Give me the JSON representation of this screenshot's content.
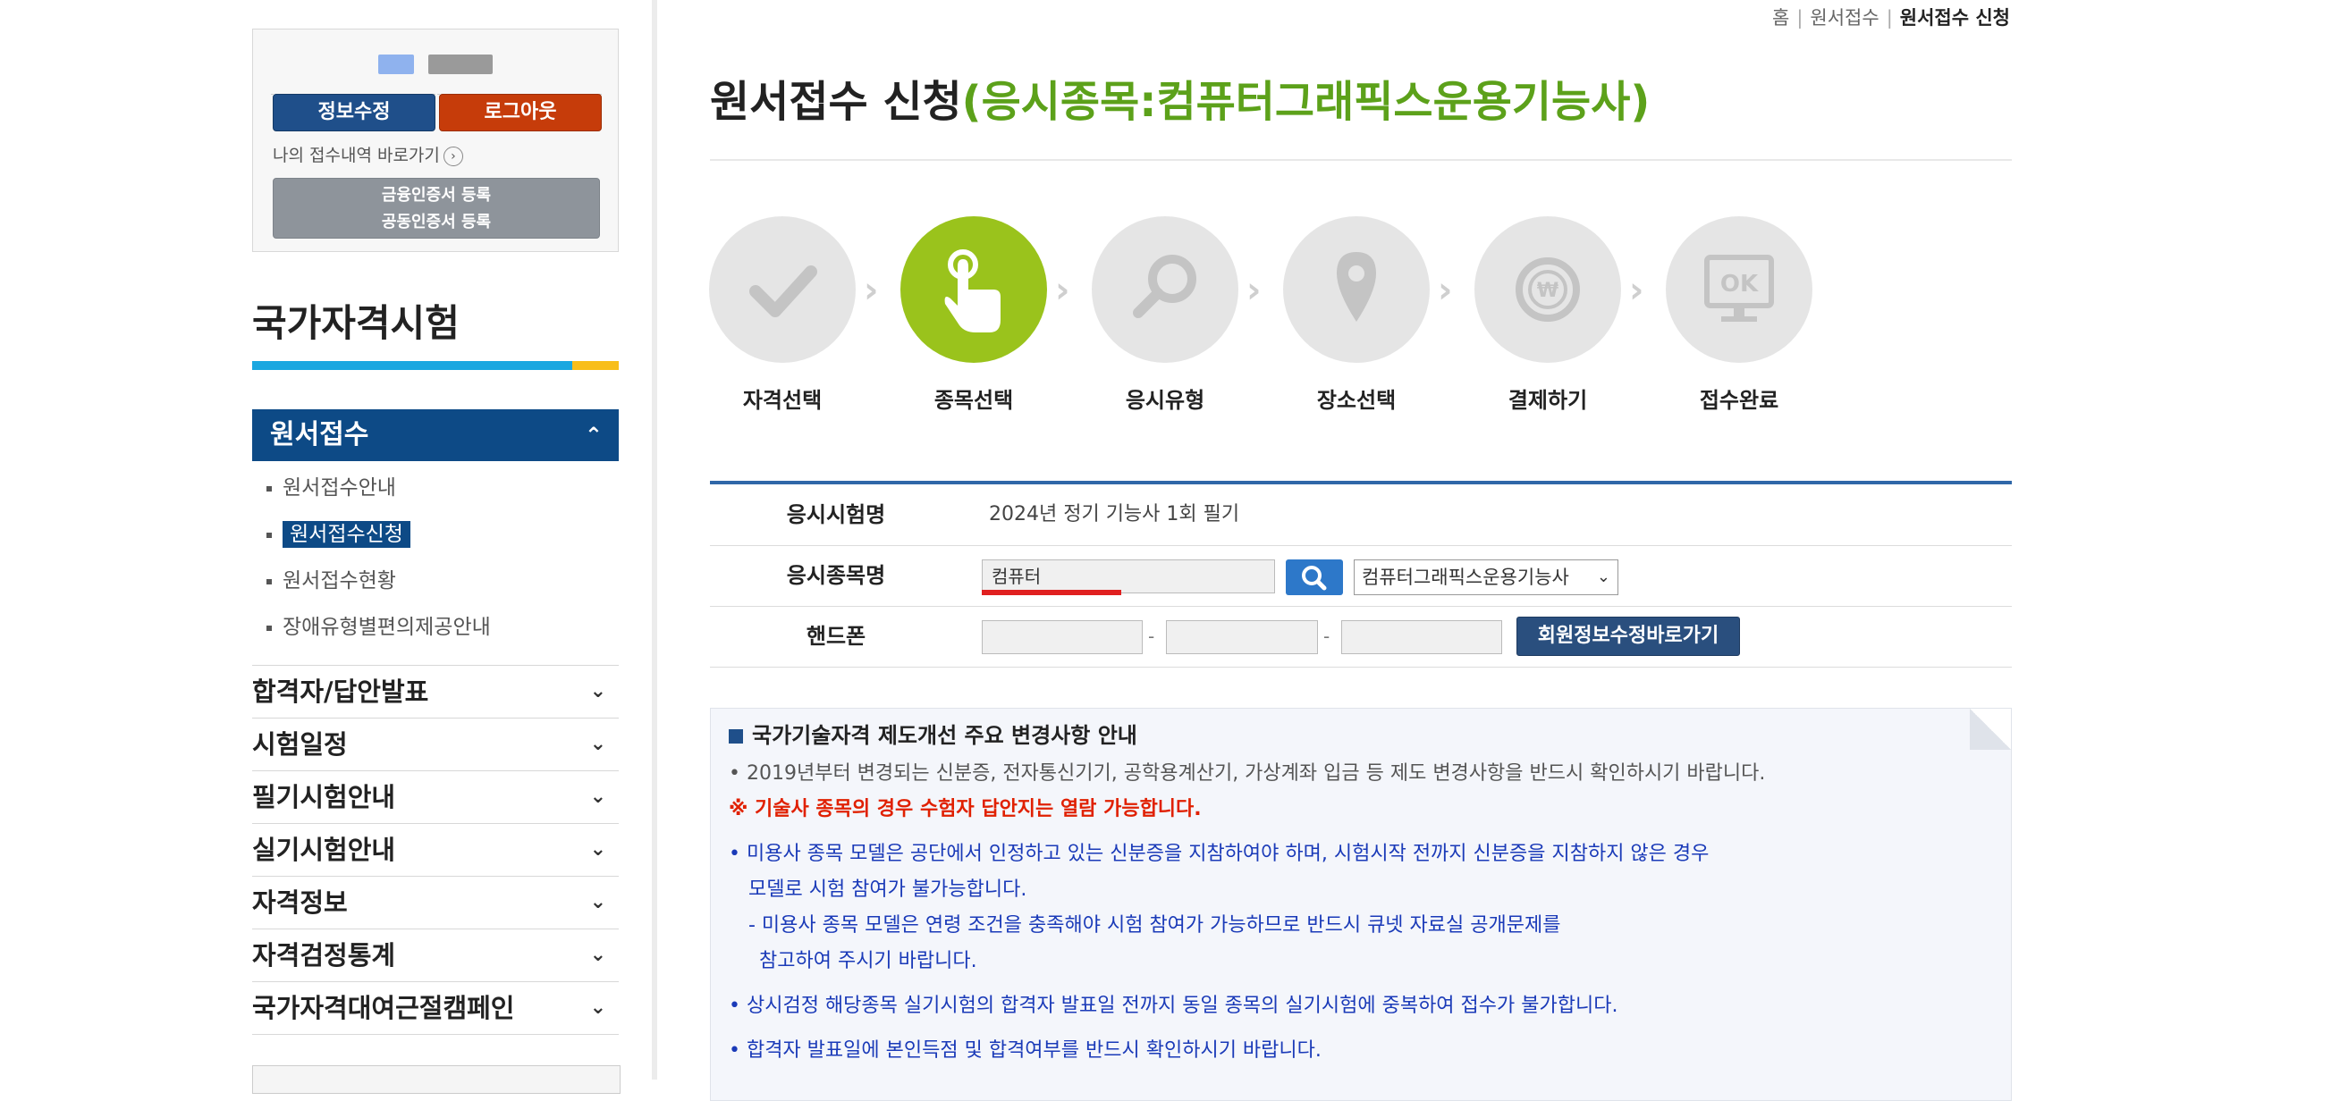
{
  "sidebar": {
    "login": {
      "edit_button": "정보수정",
      "logout_button": "로그아웃",
      "my_receipt_link": "나의 접수내역 바로가기",
      "cert_register": [
        "금융인증서 등록",
        "공동인증서 등록"
      ]
    },
    "section_title": "국가자격시험",
    "active_menu": "원서접수",
    "sub_items": [
      "원서접수안내",
      "원서접수신청",
      "원서접수현황",
      "장애유형별편의제공안내"
    ],
    "selected_sub_index": 1,
    "menu_items": [
      "합격자/답안발표",
      "시험일정",
      "필기시험안내",
      "실기시험안내",
      "자격정보",
      "자격검정통계",
      "국가자격대여근절캠페인"
    ]
  },
  "breadcrumb": [
    "홈",
    "원서접수",
    "원서접수 신청"
  ],
  "page_title": {
    "main": "원서접수 신청",
    "sub": "(응시종목:컴퓨터그래픽스운용기능사)"
  },
  "steps": [
    {
      "label": "자격선택",
      "icon": "check-icon",
      "active": false
    },
    {
      "label": "종목선택",
      "icon": "pointer-hand-icon",
      "active": true
    },
    {
      "label": "응시유형",
      "icon": "magnifier-icon",
      "active": false
    },
    {
      "label": "장소선택",
      "icon": "location-pin-icon",
      "active": false
    },
    {
      "label": "결제하기",
      "icon": "won-coin-icon",
      "active": false
    },
    {
      "label": "접수완료",
      "icon": "ok-monitor-icon",
      "active": false
    }
  ],
  "form": {
    "exam_name_label": "응시시험명",
    "exam_name_value": "2024년 정기 기능사 1회 필기",
    "subject_label": "응시종목명",
    "subject_input": "컴퓨터",
    "subject_select": "컴퓨터그래픽스운용기능사",
    "phone_label": "핸드폰",
    "phone_separator": "-",
    "member_edit_button": "회원정보수정바로가기"
  },
  "notice": {
    "title": "국가기술자격 제도개선 주요 변경사항 안내",
    "lines": [
      "• 2019년부터 변경되는 신분증, 전자통신기기, 공학용계산기, 가상계좌 입금 등 제도 변경사항을 반드시 확인하시기 바랍니다.",
      "※ 기술사 종목의 경우 수험자 답안지는 열람 가능합니다.",
      "• 미용사 종목 모델은 공단에서 인정하고 있는 신분증을 지참하여야 하며, 시험시작 전까지 신분증을 지참하지 않은 경우",
      "모델로 시험 참여가 불가능합니다.",
      "- 미용사 종목 모델은 연령 조건을 충족해야 시험 참여가 가능하므로 반드시 큐넷 자료실 공개문제를",
      "참고하여 주시기 바랍니다.",
      "• 상시검정 해당종목 실기시험의 합격자 발표일 전까지 동일 종목의 실기시험에 중복하여 접수가 불가합니다.",
      "• 합격자 발표일에 본인득점 및 합격여부를 반드시 확인하시기 바랍니다."
    ]
  },
  "colors": {
    "primary_blue": "#0d4a86",
    "accent_green": "#5ca11a",
    "step_active": "#9ac31c",
    "logout_red": "#c63c0a",
    "notice_red": "#e02000",
    "notice_blue": "#1a3ab8"
  }
}
